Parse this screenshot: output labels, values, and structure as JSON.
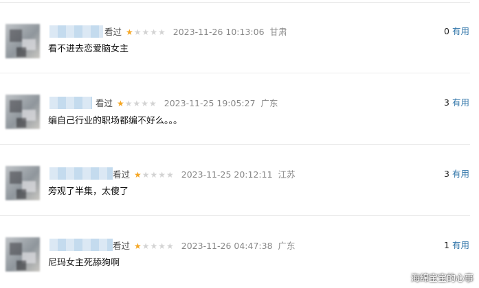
{
  "reviews": [
    {
      "watched": "看过",
      "stars": 1,
      "time": "2023-11-26 10:13:06",
      "location": "甘肃",
      "useful_count": "0",
      "useful_label": "有用",
      "content": "看不进去恋爱脑女主"
    },
    {
      "watched": "看过",
      "stars": 1,
      "time": "2023-11-25 19:05:27",
      "location": "广东",
      "useful_count": "3",
      "useful_label": "有用",
      "content": "编自己行业的职场都编不好么。。。"
    },
    {
      "watched": "看过",
      "stars": 1,
      "time": "2023-11-25 20:12:11",
      "location": "江苏",
      "useful_count": "3",
      "useful_label": "有用",
      "content": "旁观了半集，太傻了"
    },
    {
      "watched": "看过",
      "stars": 1,
      "time": "2023-11-26 04:47:38",
      "location": "广东",
      "useful_count": "1",
      "useful_label": "有用",
      "content": "尼玛女主死舔狗啊"
    }
  ],
  "watermark": "海绵宝宝的心事",
  "colors": {
    "star_on": "#f5a623",
    "star_off": "#d3d3d3",
    "useful_label": "#3377aa"
  }
}
